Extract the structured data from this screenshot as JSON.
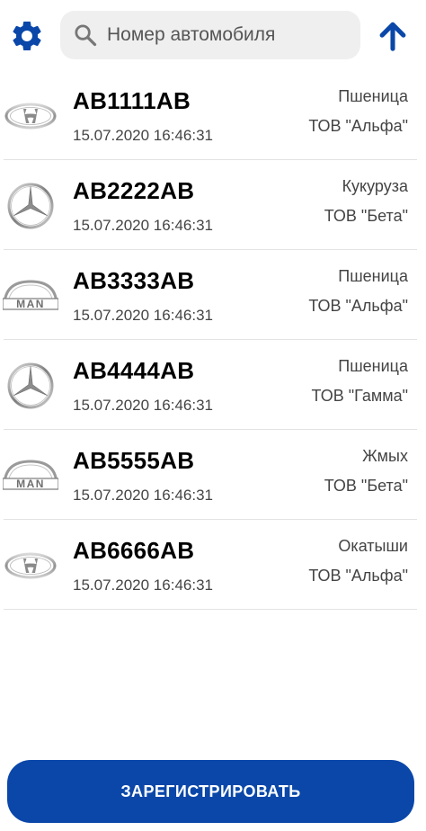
{
  "colors": {
    "accent": "#0A47A9",
    "icon_blue": "#0A47A9",
    "search_bg": "#EFEFEF",
    "divider": "#E3E3E3",
    "secondary_text": "#444444"
  },
  "header": {
    "settings_icon": "gear-icon",
    "search_icon": "search-icon",
    "search_placeholder": "Номер автомобиля",
    "search_value": "",
    "sort_icon": "arrow-up-icon"
  },
  "vehicles": [
    {
      "brand": "hyundai",
      "plate": "AB1111AB",
      "datetime": "15.07.2020 16:46:31",
      "cargo": "Пшеница",
      "company": "ТОВ \"Альфа\""
    },
    {
      "brand": "mercedes",
      "plate": "AB2222AB",
      "datetime": "15.07.2020 16:46:31",
      "cargo": "Кукуруза",
      "company": "ТОВ \"Бета\""
    },
    {
      "brand": "man",
      "plate": "AB3333AB",
      "datetime": "15.07.2020 16:46:31",
      "cargo": "Пшеница",
      "company": "ТОВ \"Альфа\""
    },
    {
      "brand": "mercedes",
      "plate": "AB4444AB",
      "datetime": "15.07.2020 16:46:31",
      "cargo": "Пшеница",
      "company": "ТОВ \"Гамма\""
    },
    {
      "brand": "man",
      "plate": "AB5555AB",
      "datetime": "15.07.2020 16:46:31",
      "cargo": "Жмых",
      "company": "ТОВ \"Бета\""
    },
    {
      "brand": "hyundai",
      "plate": "AB6666AB",
      "datetime": "15.07.2020 16:46:31",
      "cargo": "Окатыши",
      "company": "ТОВ \"Альфа\""
    }
  ],
  "footer": {
    "register_label": "ЗАРЕГИСТРИРОВАТЬ"
  }
}
